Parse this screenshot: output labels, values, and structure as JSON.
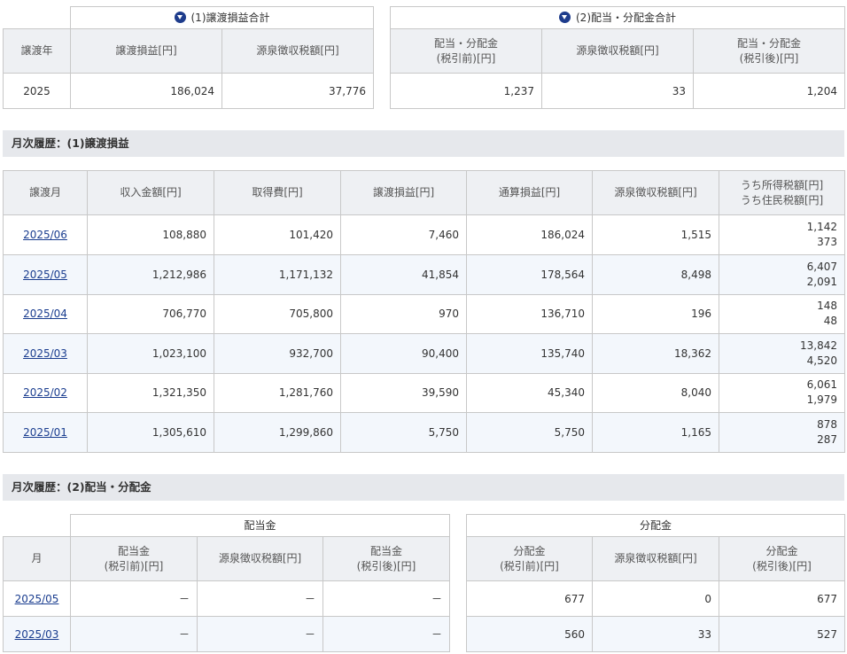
{
  "summary": {
    "transfer": {
      "title": "(1)譲渡損益合計",
      "headers": {
        "year": "譲渡年",
        "gain": "譲渡損益[円]",
        "tax": "源泉徴収税額[円]"
      },
      "row": {
        "year": "2025",
        "gain": "186,024",
        "tax": "37,776"
      }
    },
    "dividend": {
      "title": "(2)配当・分配金合計",
      "headers": {
        "pre_l1": "配当・分配金",
        "pre_l2": "(税引前)[円]",
        "tax": "源泉徴収税額[円]",
        "post_l1": "配当・分配金",
        "post_l2": "(税引後)[円]"
      },
      "row": {
        "pre": "1,237",
        "tax": "33",
        "post": "1,204"
      }
    }
  },
  "monthly_transfer": {
    "title": "月次履歴：(1)譲渡損益",
    "headers": {
      "month": "譲渡月",
      "income": "収入金額[円]",
      "cost": "取得費[円]",
      "gain": "譲渡損益[円]",
      "cumulative": "通算損益[円]",
      "tax": "源泉徴収税額[円]",
      "income_tax": "うち所得税額[円]",
      "resident_tax": "うち住民税額[円]"
    },
    "rows": [
      {
        "month": "2025/06",
        "income": "108,880",
        "cost": "101,420",
        "gain": "7,460",
        "cumulative": "186,024",
        "tax": "1,515",
        "income_tax": "1,142",
        "resident_tax": "373"
      },
      {
        "month": "2025/05",
        "income": "1,212,986",
        "cost": "1,171,132",
        "gain": "41,854",
        "cumulative": "178,564",
        "tax": "8,498",
        "income_tax": "6,407",
        "resident_tax": "2,091"
      },
      {
        "month": "2025/04",
        "income": "706,770",
        "cost": "705,800",
        "gain": "970",
        "cumulative": "136,710",
        "tax": "196",
        "income_tax": "148",
        "resident_tax": "48"
      },
      {
        "month": "2025/03",
        "income": "1,023,100",
        "cost": "932,700",
        "gain": "90,400",
        "cumulative": "135,740",
        "tax": "18,362",
        "income_tax": "13,842",
        "resident_tax": "4,520"
      },
      {
        "month": "2025/02",
        "income": "1,321,350",
        "cost": "1,281,760",
        "gain": "39,590",
        "cumulative": "45,340",
        "tax": "8,040",
        "income_tax": "6,061",
        "resident_tax": "1,979"
      },
      {
        "month": "2025/01",
        "income": "1,305,610",
        "cost": "1,299,860",
        "gain": "5,750",
        "cumulative": "5,750",
        "tax": "1,165",
        "income_tax": "878",
        "resident_tax": "287"
      }
    ]
  },
  "monthly_dividend": {
    "title": "月次履歴：(2)配当・分配金",
    "groups": {
      "dividend": "配当金",
      "distribution": "分配金"
    },
    "headers": {
      "month": "月",
      "div_pre_l1": "配当金",
      "div_pre_l2": "(税引前)[円]",
      "div_tax": "源泉徴収税額[円]",
      "div_post_l1": "配当金",
      "div_post_l2": "(税引後)[円]",
      "dist_pre_l1": "分配金",
      "dist_pre_l2": "(税引前)[円]",
      "dist_tax": "源泉徴収税額[円]",
      "dist_post_l1": "分配金",
      "dist_post_l2": "(税引後)[円]"
    },
    "rows": [
      {
        "month": "2025/05",
        "div_pre": "－",
        "div_tax": "－",
        "div_post": "－",
        "dist_pre": "677",
        "dist_tax": "0",
        "dist_post": "677"
      },
      {
        "month": "2025/03",
        "div_pre": "－",
        "div_tax": "－",
        "div_post": "－",
        "dist_pre": "560",
        "dist_tax": "33",
        "dist_post": "527"
      }
    ]
  },
  "colors": {
    "link": "#1a3d8f",
    "header_bg": "#eef0f3",
    "alt_row_bg": "#f3f7fc",
    "section_bg": "#e6e8ec",
    "icon": "#1e3c8c"
  }
}
